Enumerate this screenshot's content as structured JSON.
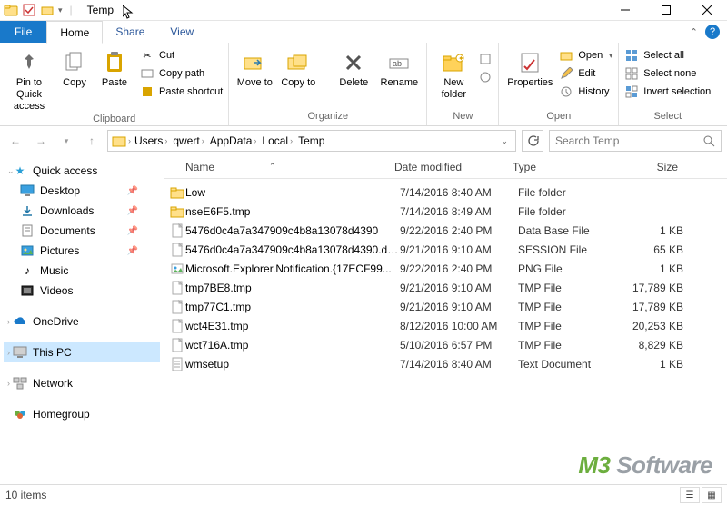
{
  "window": {
    "title": "Temp"
  },
  "menubar": {
    "file": "File",
    "home": "Home",
    "share": "Share",
    "view": "View"
  },
  "ribbon": {
    "clipboard": {
      "label": "Clipboard",
      "pin": "Pin to Quick access",
      "copy": "Copy",
      "paste": "Paste",
      "cut": "Cut",
      "copy_path": "Copy path",
      "paste_shortcut": "Paste shortcut"
    },
    "organize": {
      "label": "Organize",
      "move_to": "Move to",
      "copy_to": "Copy to",
      "delete": "Delete",
      "rename": "Rename"
    },
    "new": {
      "label": "New",
      "new_folder": "New folder"
    },
    "open": {
      "label": "Open",
      "properties": "Properties",
      "open": "Open",
      "edit": "Edit",
      "history": "History"
    },
    "select": {
      "label": "Select",
      "select_all": "Select all",
      "select_none": "Select none",
      "invert": "Invert selection"
    }
  },
  "breadcrumb": [
    "Users",
    "qwert",
    "AppData",
    "Local",
    "Temp"
  ],
  "search": {
    "placeholder": "Search Temp"
  },
  "columns": {
    "name": "Name",
    "date": "Date modified",
    "type": "Type",
    "size": "Size"
  },
  "nav": {
    "quick_access": "Quick access",
    "desktop": "Desktop",
    "downloads": "Downloads",
    "documents": "Documents",
    "pictures": "Pictures",
    "music": "Music",
    "videos": "Videos",
    "onedrive": "OneDrive",
    "this_pc": "This PC",
    "network": "Network",
    "homegroup": "Homegroup"
  },
  "files": [
    {
      "icon": "folder",
      "name": "Low",
      "date": "7/14/2016 8:40 AM",
      "type": "File folder",
      "size": ""
    },
    {
      "icon": "folder",
      "name": "nseE6F5.tmp",
      "date": "7/14/2016 8:49 AM",
      "type": "File folder",
      "size": ""
    },
    {
      "icon": "file",
      "name": "5476d0c4a7a347909c4b8a13078d4390",
      "date": "9/22/2016 2:40 PM",
      "type": "Data Base File",
      "size": "1 KB"
    },
    {
      "icon": "file",
      "name": "5476d0c4a7a347909c4b8a13078d4390.db...",
      "date": "9/21/2016 9:10 AM",
      "type": "SESSION File",
      "size": "65 KB"
    },
    {
      "icon": "image",
      "name": "Microsoft.Explorer.Notification.{17ECF99...",
      "date": "9/22/2016 2:40 PM",
      "type": "PNG File",
      "size": "1 KB"
    },
    {
      "icon": "file",
      "name": "tmp7BE8.tmp",
      "date": "9/21/2016 9:10 AM",
      "type": "TMP File",
      "size": "17,789 KB"
    },
    {
      "icon": "file",
      "name": "tmp77C1.tmp",
      "date": "9/21/2016 9:10 AM",
      "type": "TMP File",
      "size": "17,789 KB"
    },
    {
      "icon": "file",
      "name": "wct4E31.tmp",
      "date": "8/12/2016 10:00 AM",
      "type": "TMP File",
      "size": "20,253 KB"
    },
    {
      "icon": "file",
      "name": "wct716A.tmp",
      "date": "5/10/2016 6:57 PM",
      "type": "TMP File",
      "size": "8,829 KB"
    },
    {
      "icon": "text",
      "name": "wmsetup",
      "date": "7/14/2016 8:40 AM",
      "type": "Text Document",
      "size": "1 KB"
    }
  ],
  "status": {
    "items": "10 items"
  },
  "watermark": {
    "m3": "M3",
    "rest": " Software"
  }
}
